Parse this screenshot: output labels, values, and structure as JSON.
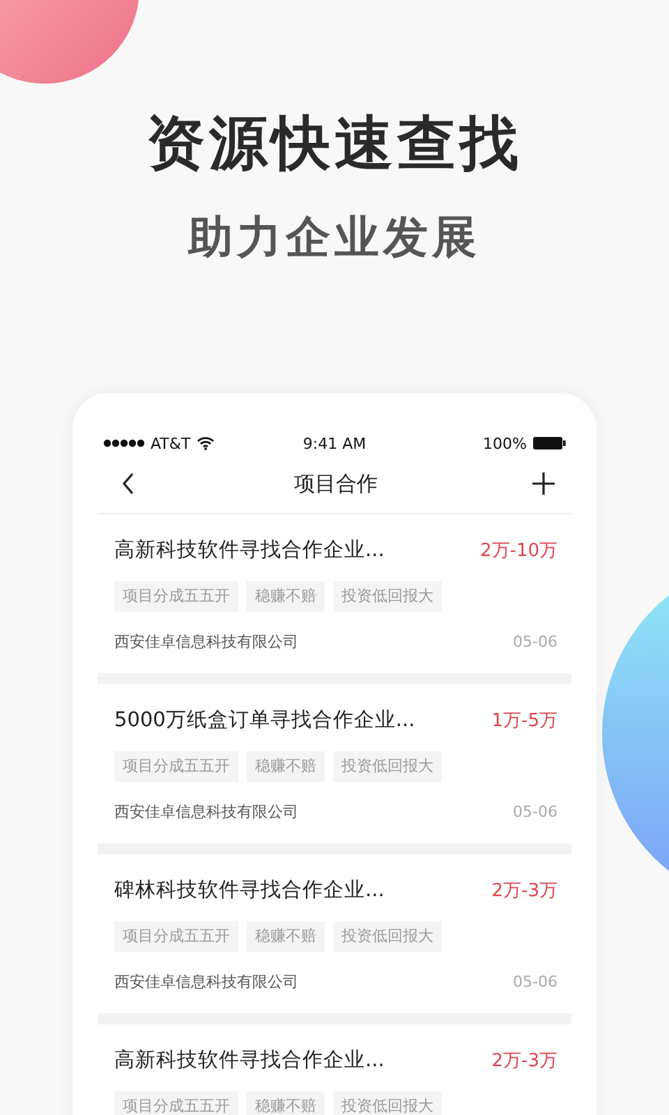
{
  "headline": "资源快速查找",
  "subheadline": "助力企业发展",
  "status_bar": {
    "carrier": "AT&T",
    "time": "9:41 AM",
    "battery": "100%"
  },
  "nav": {
    "title": "项目合作"
  },
  "projects": [
    {
      "title": "高新科技软件寻找合作企业...",
      "price": "2万-10万",
      "tags": [
        "项目分成五五开",
        "稳赚不赔",
        "投资低回报大"
      ],
      "company": "西安佳卓信息科技有限公司",
      "date": "05-06"
    },
    {
      "title": "5000万纸盒订单寻找合作企业...",
      "price": "1万-5万",
      "tags": [
        "项目分成五五开",
        "稳赚不赔",
        "投资低回报大"
      ],
      "company": "西安佳卓信息科技有限公司",
      "date": "05-06"
    },
    {
      "title": "碑林科技软件寻找合作企业...",
      "price": "2万-3万",
      "tags": [
        "项目分成五五开",
        "稳赚不赔",
        "投资低回报大"
      ],
      "company": "西安佳卓信息科技有限公司",
      "date": "05-06"
    },
    {
      "title": "高新科技软件寻找合作企业...",
      "price": "2万-3万",
      "tags": [
        "项目分成五五开",
        "稳赚不赔",
        "投资低回报大"
      ]
    }
  ]
}
